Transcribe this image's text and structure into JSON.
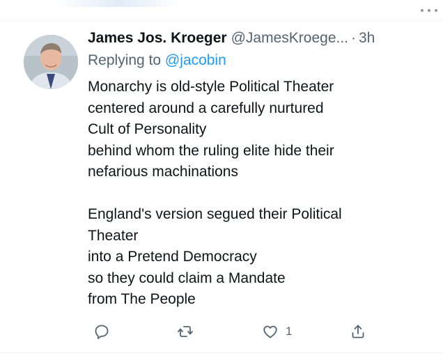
{
  "tweet": {
    "author": {
      "display_name": "James Jos. Kroeger",
      "handle": "@JamesKroege...",
      "time": "3h"
    },
    "separator": "·",
    "replying_prefix": "Replying to",
    "replying_to": "@jacobin",
    "lines": [
      "Monarchy is old-style Political Theater",
      "centered around a carefully nurtured",
      "Cult of Personality",
      "behind whom the ruling elite hide their",
      "nefarious machinations",
      "",
      "England's version segued their Political",
      "Theater",
      "into a Pretend Democracy",
      "so they could claim a Mandate",
      "from The People"
    ],
    "actions": {
      "reply_icon": "reply-icon",
      "retweet_icon": "retweet-icon",
      "like_icon": "heart-icon",
      "like_count": "1",
      "share_icon": "share-icon"
    }
  },
  "colors": {
    "text": "#0f1419",
    "secondary": "#536471",
    "link": "#1d9bf0",
    "divider": "#eff3f4"
  }
}
